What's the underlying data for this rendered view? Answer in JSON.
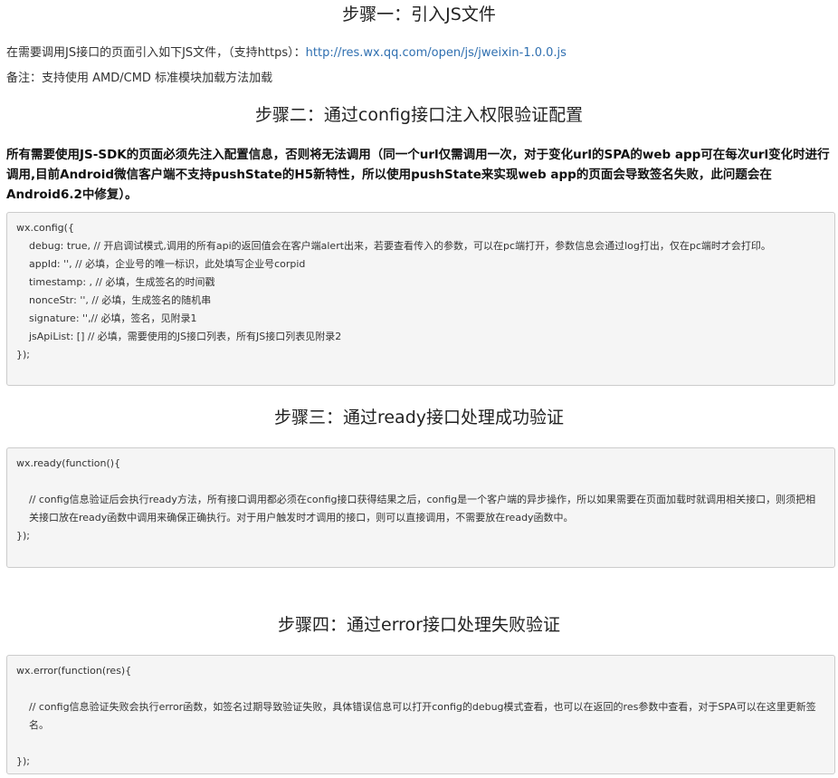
{
  "step1": {
    "title": "步骤一：引入JS文件",
    "text_prefix": "在需要调用JS接口的页面引入如下JS文件，（支持https）：",
    "link": "http://res.wx.qq.com/open/js/jweixin-1.0.0.js",
    "note": "备注：支持使用 AMD/CMD 标准模块加载方法加载"
  },
  "step2": {
    "title": "步骤二：通过config接口注入权限验证配置",
    "desc": "所有需要使用JS-SDK的页面必须先注入配置信息，否则将无法调用（同一个url仅需调用一次，对于变化url的SPA的web app可在每次url变化时进行调用,目前Android微信客户端不支持pushState的H5新特性，所以使用pushState来实现web app的页面会导致签名失败，此问题会在Android6.2中修复）。",
    "code": [
      "wx.config({",
      "debug: true, // 开启调试模式,调用的所有api的返回值会在客户端alert出来，若要查看传入的参数，可以在pc端打开，参数信息会通过log打出，仅在pc端时才会打印。",
      "appId: '', // 必填，企业号的唯一标识，此处填写企业号corpid",
      "timestamp: , // 必填，生成签名的时间戳",
      "nonceStr: '', // 必填，生成签名的随机串",
      "signature: '',// 必填，签名，见附录1",
      "jsApiList: [] // 必填，需要使用的JS接口列表，所有JS接口列表见附录2",
      "});"
    ]
  },
  "step3": {
    "title": "步骤三：通过ready接口处理成功验证",
    "code": [
      "wx.ready(function(){",
      "// config信息验证后会执行ready方法，所有接口调用都必须在config接口获得结果之后，config是一个客户端的异步操作，所以如果需要在页面加载时就调用相关接口，则须把相关接口放在ready函数中调用来确保正确执行。对于用户触发时才调用的接口，则可以直接调用，不需要放在ready函数中。",
      "});"
    ]
  },
  "step4": {
    "title": "步骤四：通过error接口处理失败验证",
    "code": [
      "wx.error(function(res){",
      "// config信息验证失败会执行error函数，如签名过期导致验证失败，具体错误信息可以打开config的debug模式查看，也可以在返回的res参数中查看，对于SPA可以在这里更新签名。",
      "});"
    ]
  }
}
